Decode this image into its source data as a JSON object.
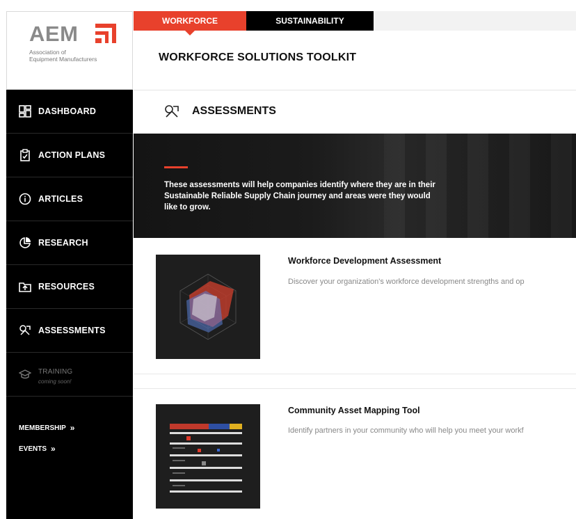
{
  "brand": {
    "logo_text": "AEM",
    "logo_subtitle_line1": "Association of",
    "logo_subtitle_line2": "Equipment Manufacturers",
    "accent_color": "#e8412c"
  },
  "tabs": [
    {
      "label": "WORKFORCE",
      "active": true
    },
    {
      "label": "SUSTAINABILITY",
      "active": false
    }
  ],
  "header": {
    "title": "WORKFORCE SOLUTIONS TOOLKIT"
  },
  "sidebar": {
    "items": [
      {
        "label": "DASHBOARD",
        "icon": "dashboard-icon"
      },
      {
        "label": "ACTION PLANS",
        "icon": "clipboard-icon"
      },
      {
        "label": "ARTICLES",
        "icon": "info-icon"
      },
      {
        "label": "RESEARCH",
        "icon": "pie-chart-icon"
      },
      {
        "label": "RESOURCES",
        "icon": "folder-icon"
      },
      {
        "label": "ASSESSMENTS",
        "icon": "assessment-icon"
      },
      {
        "label": "TRAINING",
        "sublabel": "coming soon!",
        "icon": "graduation-cap-icon",
        "disabled": true
      }
    ],
    "links": [
      {
        "label": "MEMBERSHIP",
        "chevron": "»"
      },
      {
        "label": "EVENTS",
        "chevron": "»"
      }
    ]
  },
  "section": {
    "title": "ASSESSMENTS",
    "icon": "assessment-icon"
  },
  "banner": {
    "text": "These assessments will help companies identify where they are in their Sustainable Reliable Supply Chain journey and areas were they would like to grow."
  },
  "cards": [
    {
      "title": "Workforce Development Assessment",
      "description": "Discover your organization's workforce development strengths and op"
    },
    {
      "title": "Community Asset Mapping Tool",
      "description": "Identify partners in your community who will help you meet your workf"
    }
  ]
}
